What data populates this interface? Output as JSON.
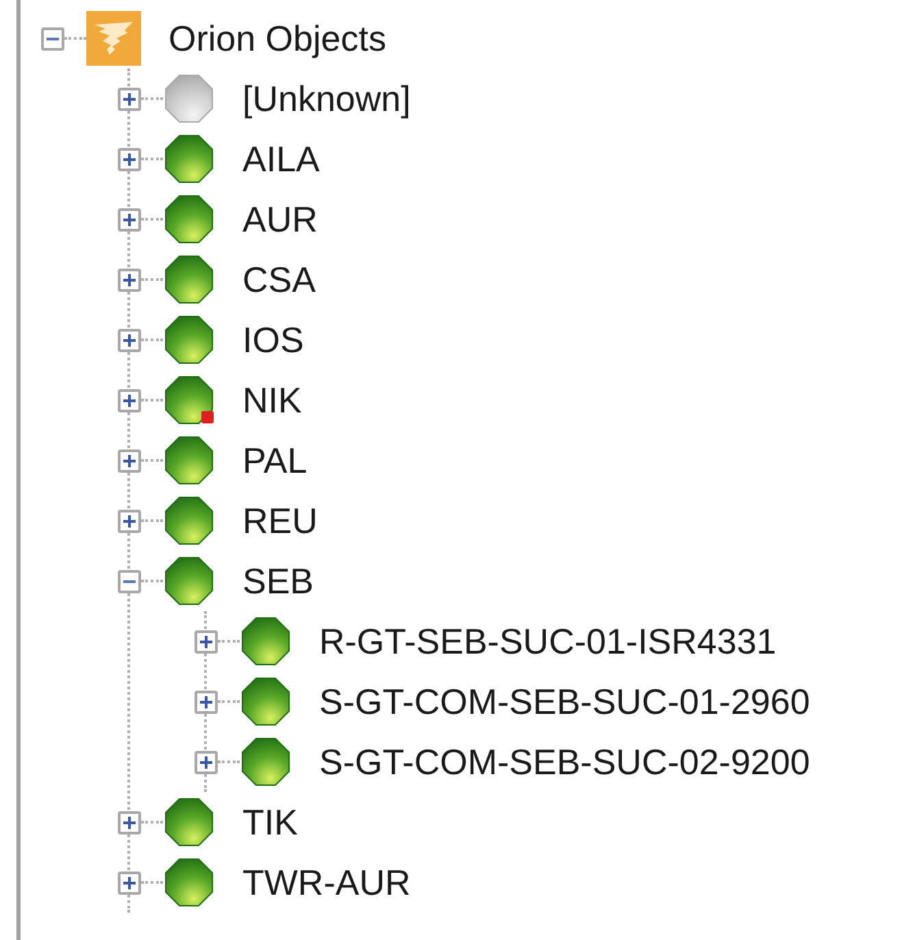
{
  "tree": [
    {
      "label": "Orion Objects",
      "kind": "root",
      "alert": false,
      "expanded": true,
      "children": [
        {
          "label": "[Unknown]",
          "kind": "unknown",
          "alert": false,
          "expanded": false
        },
        {
          "label": "AILA",
          "kind": "up",
          "alert": false,
          "expanded": false
        },
        {
          "label": "AUR",
          "kind": "up",
          "alert": false,
          "expanded": false
        },
        {
          "label": "CSA",
          "kind": "up",
          "alert": false,
          "expanded": false
        },
        {
          "label": "IOS",
          "kind": "up",
          "alert": false,
          "expanded": false
        },
        {
          "label": "NIK",
          "kind": "up",
          "alert": true,
          "expanded": false
        },
        {
          "label": "PAL",
          "kind": "up",
          "alert": false,
          "expanded": false
        },
        {
          "label": "REU",
          "kind": "up",
          "alert": false,
          "expanded": false
        },
        {
          "label": "SEB",
          "kind": "up",
          "alert": false,
          "expanded": true,
          "children": [
            {
              "label": "R-GT-SEB-SUC-01-ISR4331",
              "kind": "up",
              "alert": false,
              "expanded": false
            },
            {
              "label": "S-GT-COM-SEB-SUC-01-2960",
              "kind": "up",
              "alert": false,
              "expanded": false
            },
            {
              "label": "S-GT-COM-SEB-SUC-02-9200",
              "kind": "up",
              "alert": false,
              "expanded": false
            }
          ]
        },
        {
          "label": "TIK",
          "kind": "up",
          "alert": false,
          "expanded": false
        },
        {
          "label": "TWR-AUR",
          "kind": "up",
          "alert": false,
          "expanded": false
        }
      ]
    }
  ]
}
